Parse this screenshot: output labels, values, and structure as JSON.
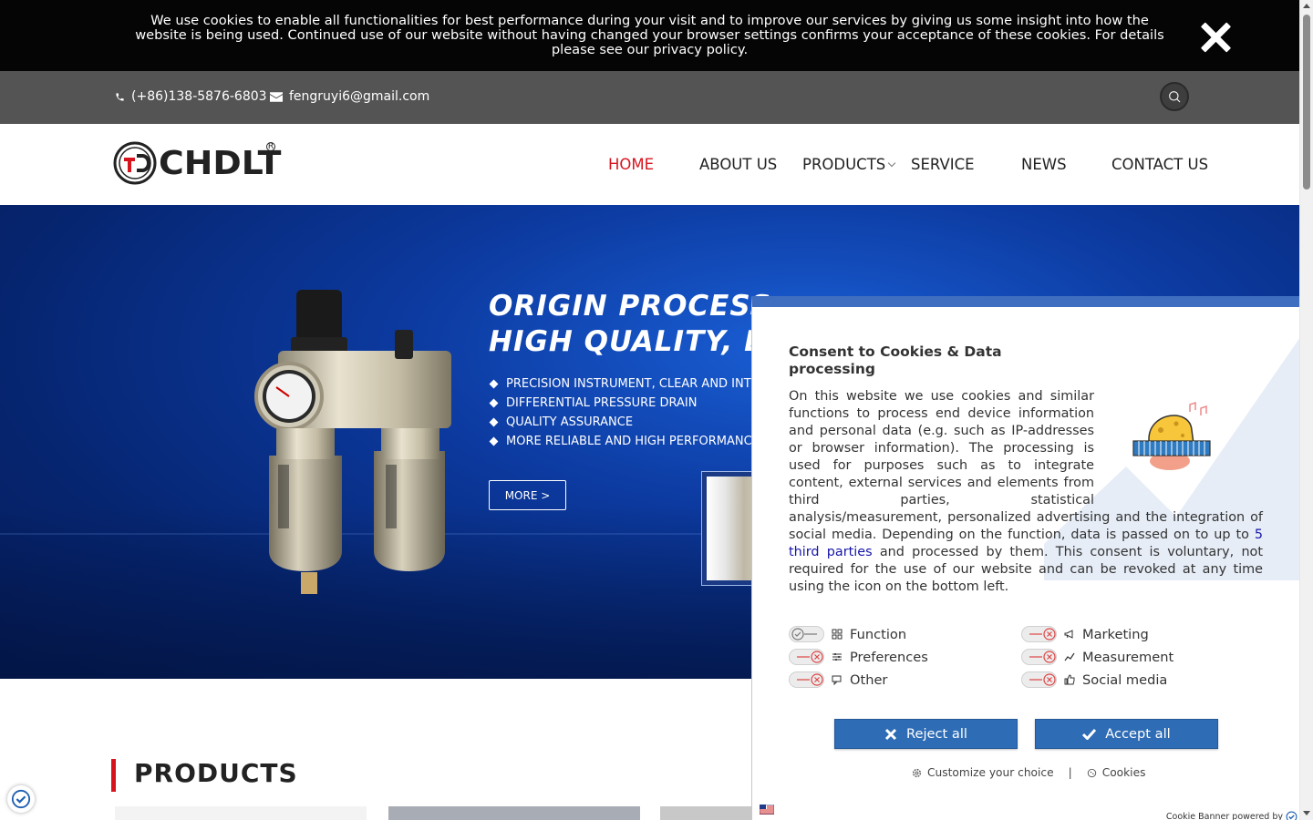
{
  "cookie_notice": {
    "text": "We use cookies to enable all functionalities for best performance during your visit and to improve our services by giving us some insight into how the website is being used. Continued use of our website without having changed your browser settings confirms your acceptance of these cookies. For details please see our privacy policy."
  },
  "contact": {
    "phone": "(+86)138-5876-6803",
    "email": "fengruyi6@gmail.com"
  },
  "header": {
    "logo_text": "CHDLT",
    "logo_reg": "R",
    "nav": [
      "HOME",
      "ABOUT US",
      "PRODUCTS",
      "SERVICE",
      "NEWS",
      "CONTACT US"
    ],
    "active_nav": "HOME"
  },
  "hero": {
    "headline_1": "ORIGIN PROCESS",
    "headline_2": "HIGH QUALITY, L",
    "bullets": [
      "PRECISION INSTRUMENT, CLEAR AND INTU",
      "DIFFERENTIAL PRESSURE DRAIN",
      "QUALITY ASSURANCE",
      "MORE RELIABLE AND HIGH PERFORMANC"
    ],
    "more_label": "MORE >"
  },
  "products": {
    "title": "PRODUCTS"
  },
  "consent": {
    "title": "Consent to Cookies & Data processing",
    "text_before_link": "On this website we use cookies and similar functions to process end device information and personal data (e.g. such as IP-addresses or browser information). The processing is used for purposes such as to integrate content, external services and elements from third parties, statistical analysis/measurement, personalized advertising and the integration of social media. Depending on the function, data is passed on to up to ",
    "link_text": "5 third parties",
    "text_after_link": " and processed by them. This consent is voluntary, not required for the use of our website and can be revoked at any time using the icon on the bottom left.",
    "categories_left": [
      "Function",
      "Preferences",
      "Other"
    ],
    "categories_right": [
      "Marketing",
      "Measurement",
      "Social media"
    ],
    "reject_label": "Reject all",
    "accept_label": "Accept all",
    "customize_label": "Customize your choice",
    "separator": "|",
    "cookies_label": "Cookies",
    "powered_by": "Cookie Banner powered by"
  },
  "colors": {
    "accent_red": "#d7141e",
    "button_blue": "#2e6cb5",
    "top_bar": "#545454"
  },
  "icons": [
    "close-icon",
    "phone-icon",
    "mail-icon",
    "search-icon",
    "chevron-down-icon",
    "toggle-on-icon",
    "toggle-off-icon",
    "consent-shield-icon",
    "language-flag-icon"
  ]
}
